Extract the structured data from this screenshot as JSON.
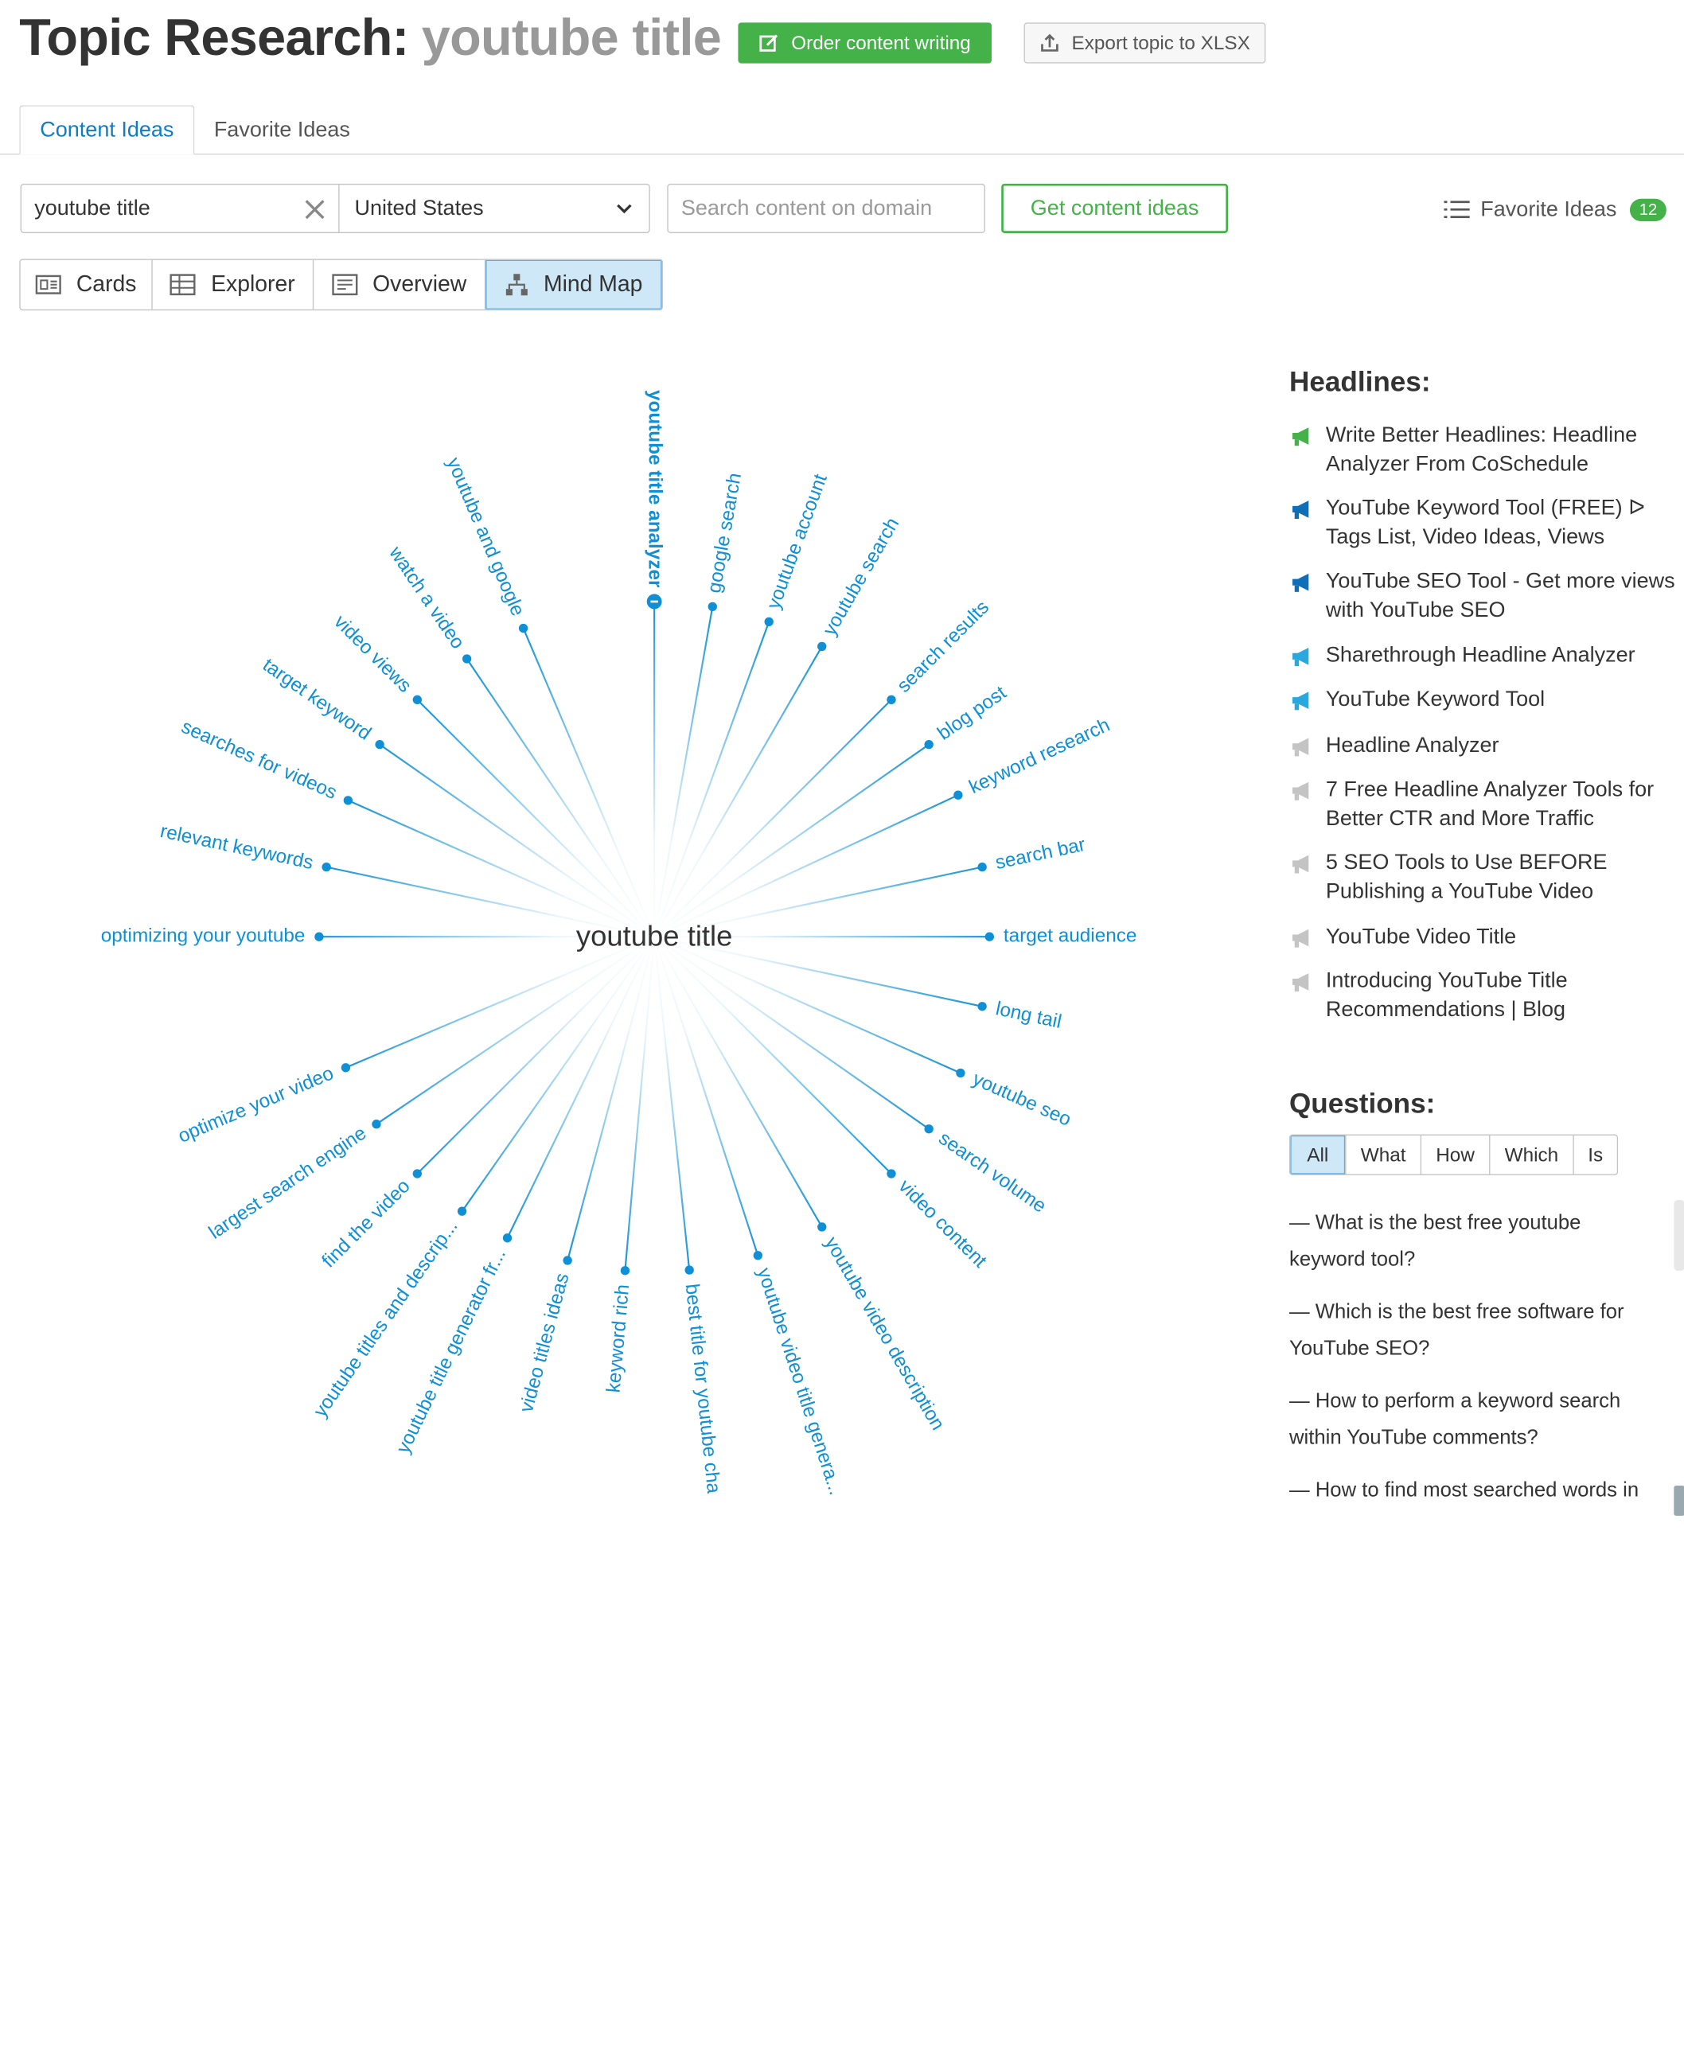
{
  "header": {
    "title_prefix": "Topic Research:",
    "title_keyword": "youtube title",
    "order_button": "Order content writing",
    "export_button": "Export topic to XLSX"
  },
  "tabs": [
    {
      "label": "Content Ideas",
      "active": true
    },
    {
      "label": "Favorite Ideas",
      "active": false
    }
  ],
  "search": {
    "value": "youtube title",
    "country": "United States",
    "domain_placeholder": "Search content on domain",
    "submit_label": "Get content ideas"
  },
  "favorites": {
    "label": "Favorite Ideas",
    "count": "12"
  },
  "views": [
    {
      "label": "Cards",
      "icon": "cards-icon"
    },
    {
      "label": "Explorer",
      "icon": "table-icon"
    },
    {
      "label": "Overview",
      "icon": "overview-icon"
    },
    {
      "label": "Mind Map",
      "icon": "hierarchy-icon",
      "active": true
    }
  ],
  "mindmap": {
    "center": "youtube title",
    "branches": [
      {
        "label": "youtube title analyzer",
        "angle": -90,
        "selected": true
      },
      {
        "label": "google search",
        "angle": -80
      },
      {
        "label": "youtube account",
        "angle": -70
      },
      {
        "label": "youtube search",
        "angle": -60
      },
      {
        "label": "search results",
        "angle": -45
      },
      {
        "label": "blog post",
        "angle": -35
      },
      {
        "label": "keyword research",
        "angle": -25
      },
      {
        "label": "search bar",
        "angle": -12
      },
      {
        "label": "target audience",
        "angle": 0
      },
      {
        "label": "long tail",
        "angle": 12
      },
      {
        "label": "youtube seo",
        "angle": 24
      },
      {
        "label": "search volume",
        "angle": 35
      },
      {
        "label": "video content",
        "angle": 45
      },
      {
        "label": "youtube video description",
        "angle": 60
      },
      {
        "label": "youtube video title genera...",
        "angle": 72
      },
      {
        "label": "best title for youtube cha",
        "angle": 84
      },
      {
        "label": "keyword rich",
        "angle": 95
      },
      {
        "label": "video titles ideas",
        "angle": 105
      },
      {
        "label": "youtube title generator fr...",
        "angle": 116
      },
      {
        "label": "youtube titles and descrip...",
        "angle": 125
      },
      {
        "label": "find the video",
        "angle": 135
      },
      {
        "label": "largest search engine",
        "angle": 146
      },
      {
        "label": "optimize your video",
        "angle": 157
      },
      {
        "label": "optimizing your youtube",
        "angle": 180
      },
      {
        "label": "relevant keywords",
        "angle": 192
      },
      {
        "label": "searches for videos",
        "angle": 204
      },
      {
        "label": "target keyword",
        "angle": 215
      },
      {
        "label": "video views",
        "angle": 225
      },
      {
        "label": "watch a video",
        "angle": 236
      },
      {
        "label": "youtube and google",
        "angle": 247
      }
    ]
  },
  "headlines": {
    "title": "Headlines:",
    "items": [
      {
        "text": "Write Better Headlines: Headline Analyzer From CoSchedule",
        "icon_color": "#44b248"
      },
      {
        "text": "YouTube Keyword Tool (FREE) ᐅ Tags List, Video Ideas, Views",
        "icon_color": "#0e6eb8"
      },
      {
        "text": "YouTube SEO Tool - Get more views with YouTube SEO",
        "icon_color": "#0e6eb8"
      },
      {
        "text": "Sharethrough Headline Analyzer",
        "icon_color": "#29a8e0"
      },
      {
        "text": "YouTube Keyword Tool",
        "icon_color": "#29a8e0"
      },
      {
        "text": "Headline Analyzer",
        "icon_color": "#c4c4c4"
      },
      {
        "text": "7 Free Headline Analyzer Tools for Better CTR and More Traffic",
        "icon_color": "#c4c4c4"
      },
      {
        "text": "5 SEO Tools to Use BEFORE Publishing a YouTube Video",
        "icon_color": "#c4c4c4"
      },
      {
        "text": "YouTube Video Title",
        "icon_color": "#c4c4c4"
      },
      {
        "text": "Introducing YouTube Title Recommendations | Blog",
        "icon_color": "#c4c4c4"
      }
    ]
  },
  "questions": {
    "title": "Questions:",
    "filters": [
      "All",
      "What",
      "How",
      "Which",
      "Is"
    ],
    "items": [
      "— What is the best free youtube keyword tool?",
      "— Which is the best free software for YouTube SEO?",
      "— How to perform a keyword search within YouTube comments?",
      "— How to find most searched words in"
    ]
  },
  "colors": {
    "accent_blue": "#0e7cc7",
    "branch_blue": "#0e8fd6",
    "green": "#44b248"
  }
}
